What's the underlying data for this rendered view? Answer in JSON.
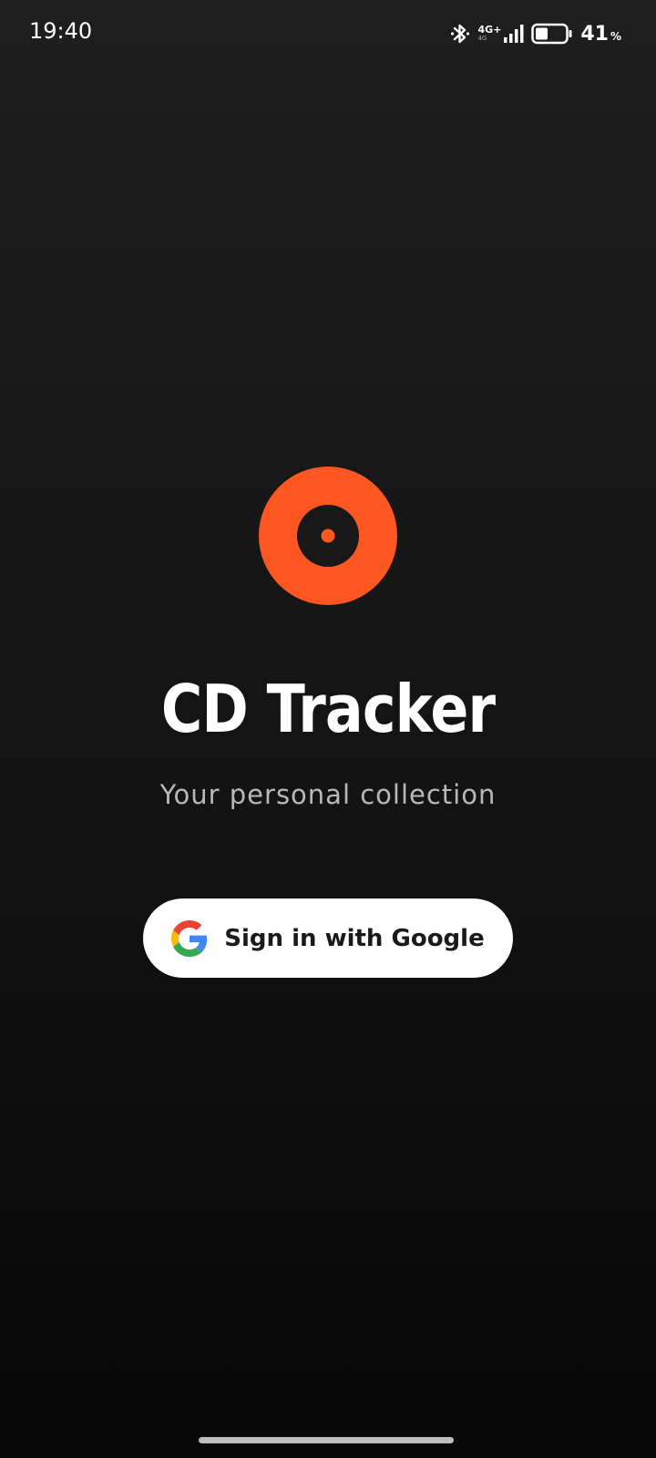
{
  "status_bar": {
    "time": "19:40",
    "network_type": "4G+",
    "network_sub": "4G",
    "battery_percent": "41",
    "battery_unit": "%",
    "battery_level": 0.41,
    "icons": [
      "bluetooth-icon",
      "signal-icon",
      "battery-icon"
    ]
  },
  "app": {
    "title": "CD Tracker",
    "subtitle": "Your personal collection",
    "logo_icon": "disc-icon",
    "accent_color": "#ff5722"
  },
  "auth": {
    "google_button_label": "Sign in with Google",
    "google_icon": "google-g-icon"
  }
}
